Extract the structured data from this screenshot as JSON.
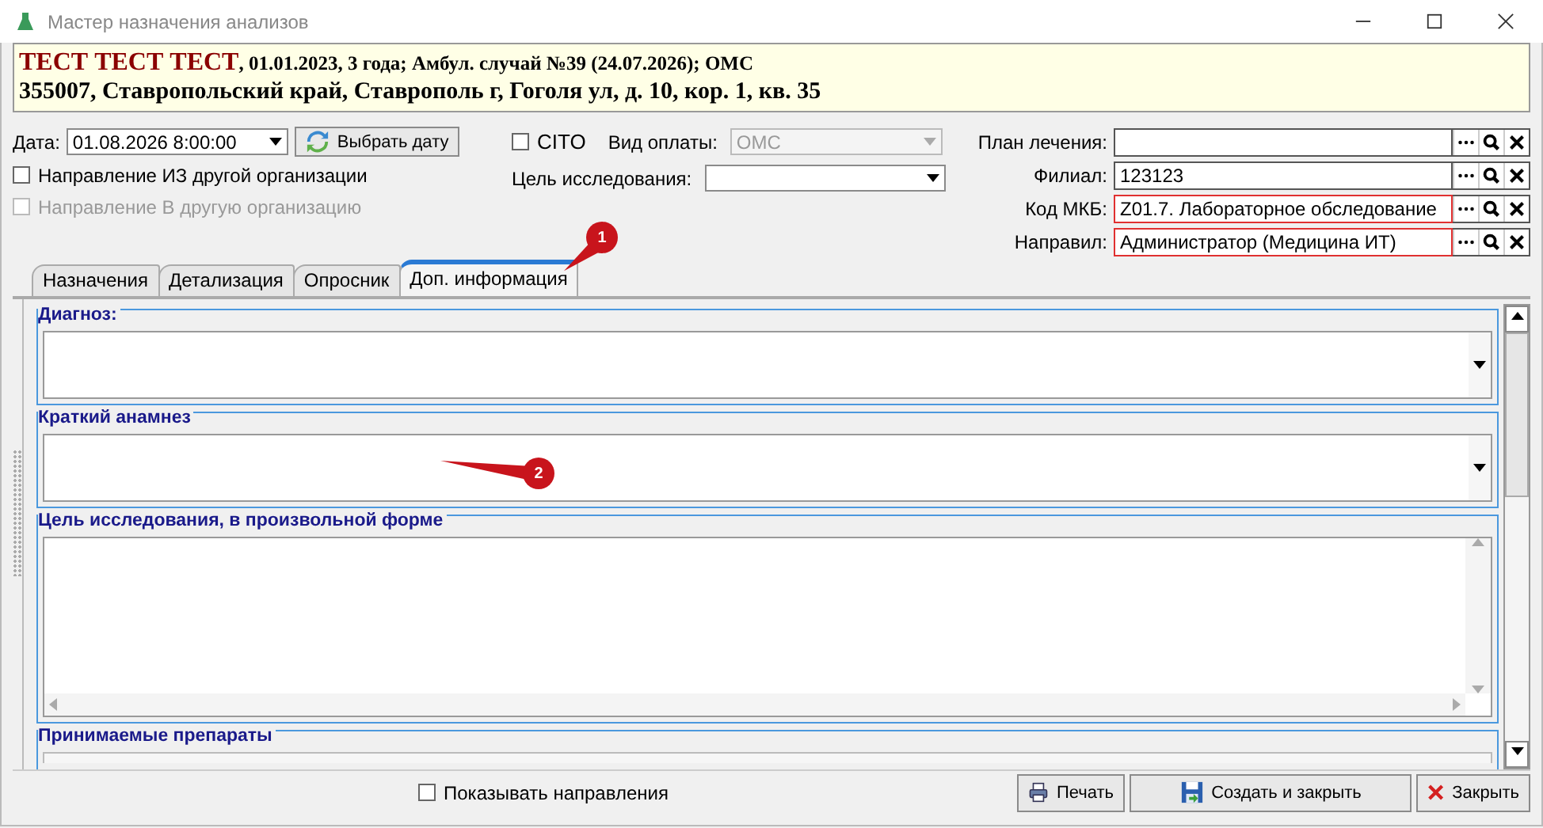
{
  "window": {
    "title": "Мастер назначения анализов"
  },
  "header": {
    "patient_name": "ТЕСТ ТЕСТ ТЕСТ",
    "patient_info": ", 01.01.2023, 3 года; Амбул. случай №39 (24.07.2026); ОМС",
    "address": "355007, Ставропольский край, Ставрополь г, Гоголя ул, д. 10, кор. 1, кв. 35"
  },
  "form": {
    "date_label": "Дата:",
    "date_value": "01.08.2026 8:00:00",
    "pick_date_button": "Выбрать дату",
    "cito": {
      "label": "CITO",
      "checked": false
    },
    "payment_label": "Вид оплаты:",
    "payment_value": "ОМС",
    "purpose_label": "Цель исследования:",
    "checkboxes": [
      {
        "label": "Направление ИЗ другой организации",
        "checked": false,
        "disabled": false
      },
      {
        "label": "Направление В другую организацию",
        "checked": false,
        "disabled": true
      }
    ],
    "lookups": [
      {
        "label": "План лечения:",
        "required": false
      },
      {
        "label": "Филиал:",
        "value": "123123",
        "required": false
      },
      {
        "label": "Код МКБ:",
        "value": "Z01.7. Лабораторное обследование",
        "required": true
      },
      {
        "label": "Направил:",
        "value": "Администратор (Медицина ИТ)",
        "required": true
      }
    ]
  },
  "tabs": [
    {
      "label": "Назначения",
      "selected": false
    },
    {
      "label": "Детализация",
      "selected": false
    },
    {
      "label": "Опросник",
      "selected": false
    },
    {
      "label": "Доп. информация",
      "selected": true
    }
  ],
  "groups": [
    {
      "title": "Диагноз:",
      "kind": "combo"
    },
    {
      "title": "Краткий анамнез",
      "kind": "combo"
    },
    {
      "title": "Цель исследования, в произвольной форме",
      "kind": "memo"
    },
    {
      "title": "Принимаемые препараты",
      "kind": "cut"
    }
  ],
  "callouts": [
    {
      "label": "1"
    },
    {
      "label": "2"
    }
  ],
  "footer": {
    "show_referrals": {
      "label": "Показывать направления",
      "checked": false
    },
    "buttons": [
      {
        "label": "Печать",
        "kind": "print"
      },
      {
        "label": "Создать и закрыть",
        "kind": "save"
      },
      {
        "label": "Закрыть",
        "kind": "close"
      }
    ]
  }
}
